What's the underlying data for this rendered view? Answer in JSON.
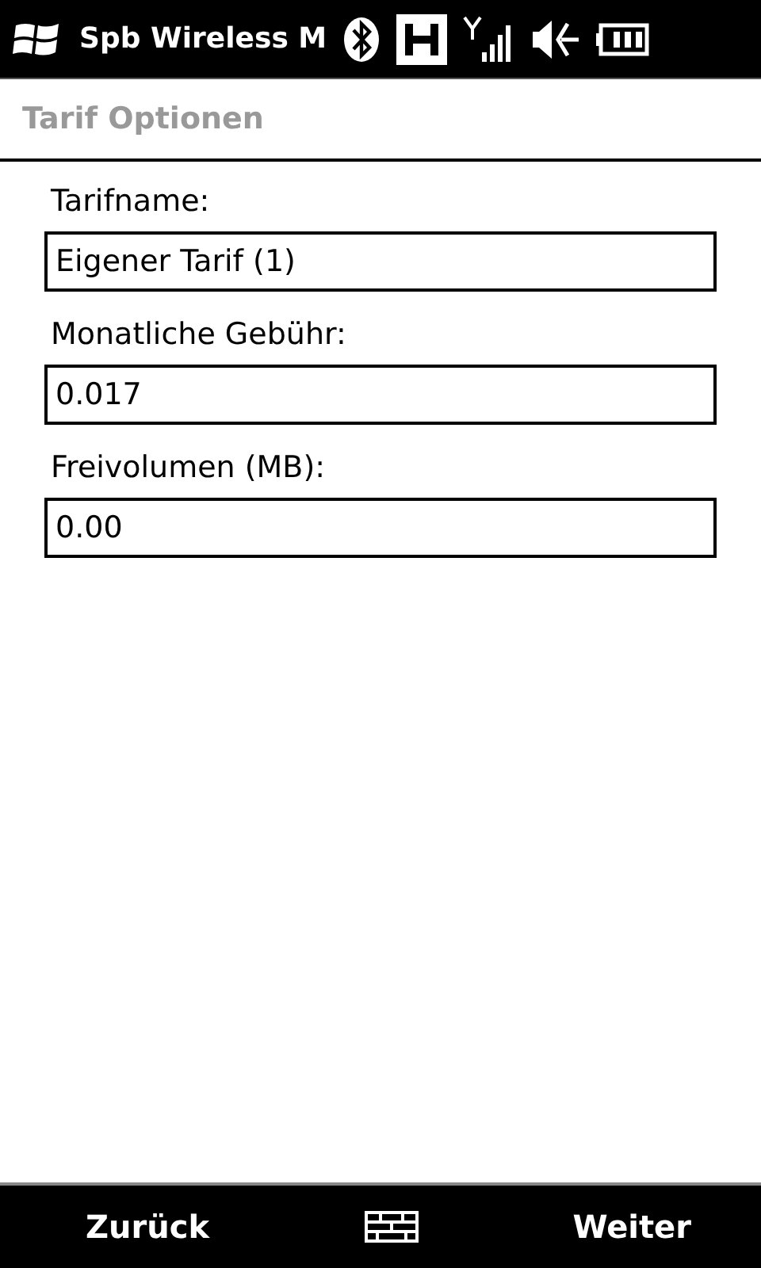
{
  "status_bar": {
    "title": "Spb Wireless M"
  },
  "header": {
    "title": "Tarif Optionen"
  },
  "fields": [
    {
      "label": "Tarifname:",
      "value": "Eigener Tarif (1)"
    },
    {
      "label": "Monatliche Gebühr:",
      "value": "0.017"
    },
    {
      "label": "Freivolumen (MB):",
      "value": "0.00"
    }
  ],
  "softkeys": {
    "left": "Zurück",
    "right": "Weiter"
  }
}
